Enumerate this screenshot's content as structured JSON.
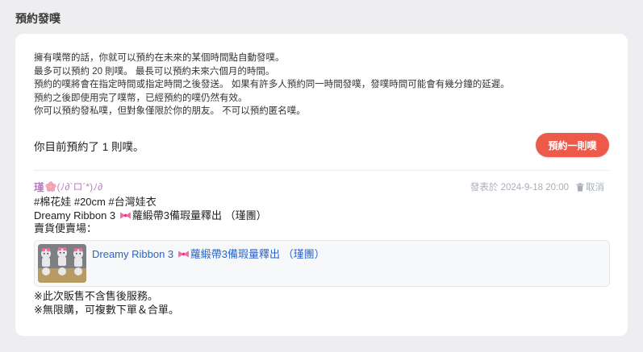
{
  "section": {
    "title": "預約發噗"
  },
  "info_lines": [
    "擁有噗幣的話，你就可以預約在未來的某個時間點自動發噗。",
    "最多可以預約 20 則噗。 最長可以預約未來六個月的時間。",
    "預約的噗將會在指定時間或指定時間之後發送。 如果有許多人預約同一時間發噗，發噗時間可能會有幾分鐘的延遲。",
    "預約之後即使用完了噗幣，已經預約的噗仍然有效。",
    "你可以預約發私噗，但對象僅限於你的朋友。 不可以預約匿名噗。"
  ],
  "status": {
    "count_text": "你目前預約了 1 則噗。"
  },
  "actions": {
    "schedule_button": "預約一則噗"
  },
  "post": {
    "author_name": "瑾",
    "author_nick": "(ﾉ∂`ロ´*)ﾉ∂",
    "scheduled_label": "發表於 2024-9-18 20:00",
    "cancel_label": "取消",
    "line1": "#棉花娃 #20cm #台灣娃衣",
    "line2_a": "Dreamy Ribbon 3 ",
    "line2_b": "蘿緞帶3備瑕量釋出 （瑾團）",
    "line3": "賣貨便賣場：",
    "link_title_a": "Dreamy Ribbon 3 ",
    "link_title_b": "蘿緞帶3備瑕量釋出 （瑾團）",
    "footer1": "※此次販售不含售後服務。",
    "footer2": "※無限購，可複數下單＆合單。"
  },
  "icons": {
    "flower": "cherry-blossom-icon",
    "bow": "ribbon-icon",
    "trash": "trash-icon"
  },
  "colors": {
    "accent_button": "#ee5a4a",
    "author": "#b880c0",
    "link": "#2a64c8",
    "meta": "#a8aeb8"
  }
}
